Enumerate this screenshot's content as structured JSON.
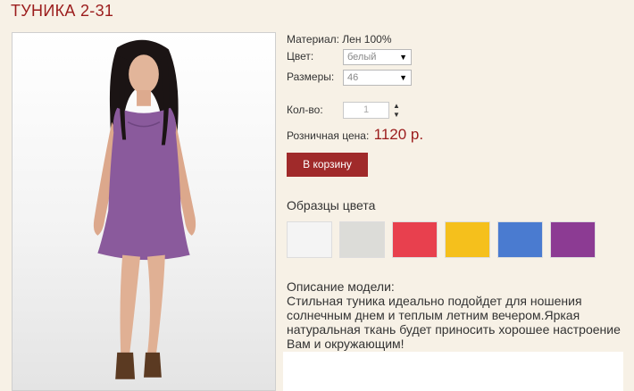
{
  "product": {
    "title": "ТУНИКА 2-31",
    "material_label": "Материал: Лен 100%",
    "color_label": "Цвет:",
    "color_value": "белый",
    "size_label": "Размеры:",
    "size_value": "46",
    "qty_label": "Кол-во:",
    "qty_value": "1",
    "price_label": "Розничная цена:",
    "price_value": "1120 р.",
    "cart_button": "В корзину"
  },
  "samples": {
    "title": "Образцы цвета",
    "swatches": [
      {
        "name": "white",
        "color": "#f4f4f4"
      },
      {
        "name": "light-gray",
        "color": "#dcdcd8"
      },
      {
        "name": "red",
        "color": "#e8404e"
      },
      {
        "name": "yellow",
        "color": "#f5c01c"
      },
      {
        "name": "blue",
        "color": "#4a7bd0"
      },
      {
        "name": "purple",
        "color": "#8c3b93"
      }
    ]
  },
  "description": {
    "title": "Описание модели:",
    "text": "Стильная туника идеально подойдет для ношения солнечным днем и теплым летним вечером.Яркая натуральная ткань будет приносить хорошее настроение Вам и окружающим!"
  },
  "colors": {
    "accent": "#9b1c1c",
    "button": "#a02a2a",
    "background": "#f7f1e6",
    "dress": "#8a5a9c"
  }
}
